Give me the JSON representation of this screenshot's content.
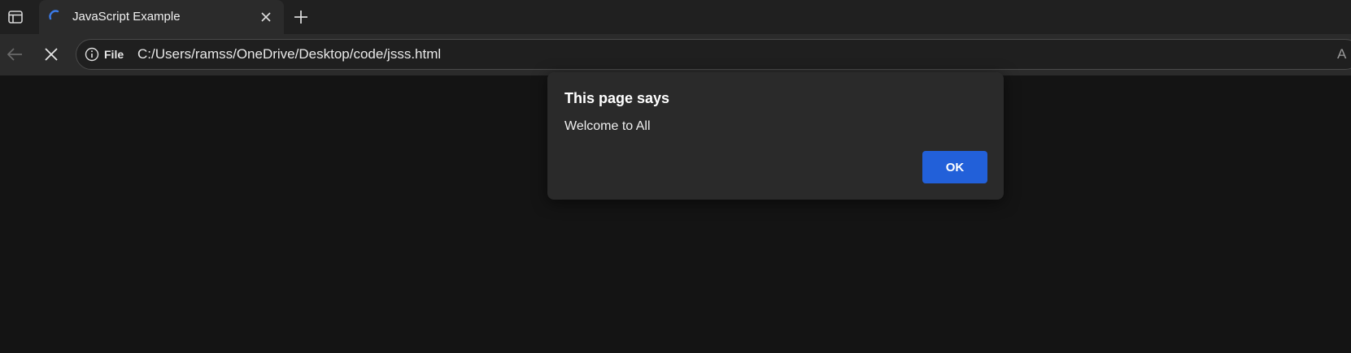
{
  "browser": {
    "tab": {
      "title": "JavaScript Example",
      "loading_icon": "loading-spinner-icon"
    },
    "icons": {
      "tab_actions": "tab-actions-icon",
      "close_tab": "close-icon",
      "new_tab": "plus-icon",
      "back": "back-arrow-icon",
      "stop": "stop-icon",
      "site_info": "info-icon",
      "read_aloud": "read-aloud-icon"
    },
    "address_bar": {
      "scheme_label": "File",
      "url": "C:/Users/ramss/OneDrive/Desktop/code/jsss.html",
      "read_aloud_glyph": "A"
    }
  },
  "dialog": {
    "title": "This page says",
    "message": "Welcome to All",
    "ok_label": "OK"
  },
  "colors": {
    "page_background": "#141414",
    "tabbar_background": "#202020",
    "toolbar_background": "#2b2b2b",
    "dialog_background": "#2a2a2a",
    "accent": "#2260d9"
  }
}
